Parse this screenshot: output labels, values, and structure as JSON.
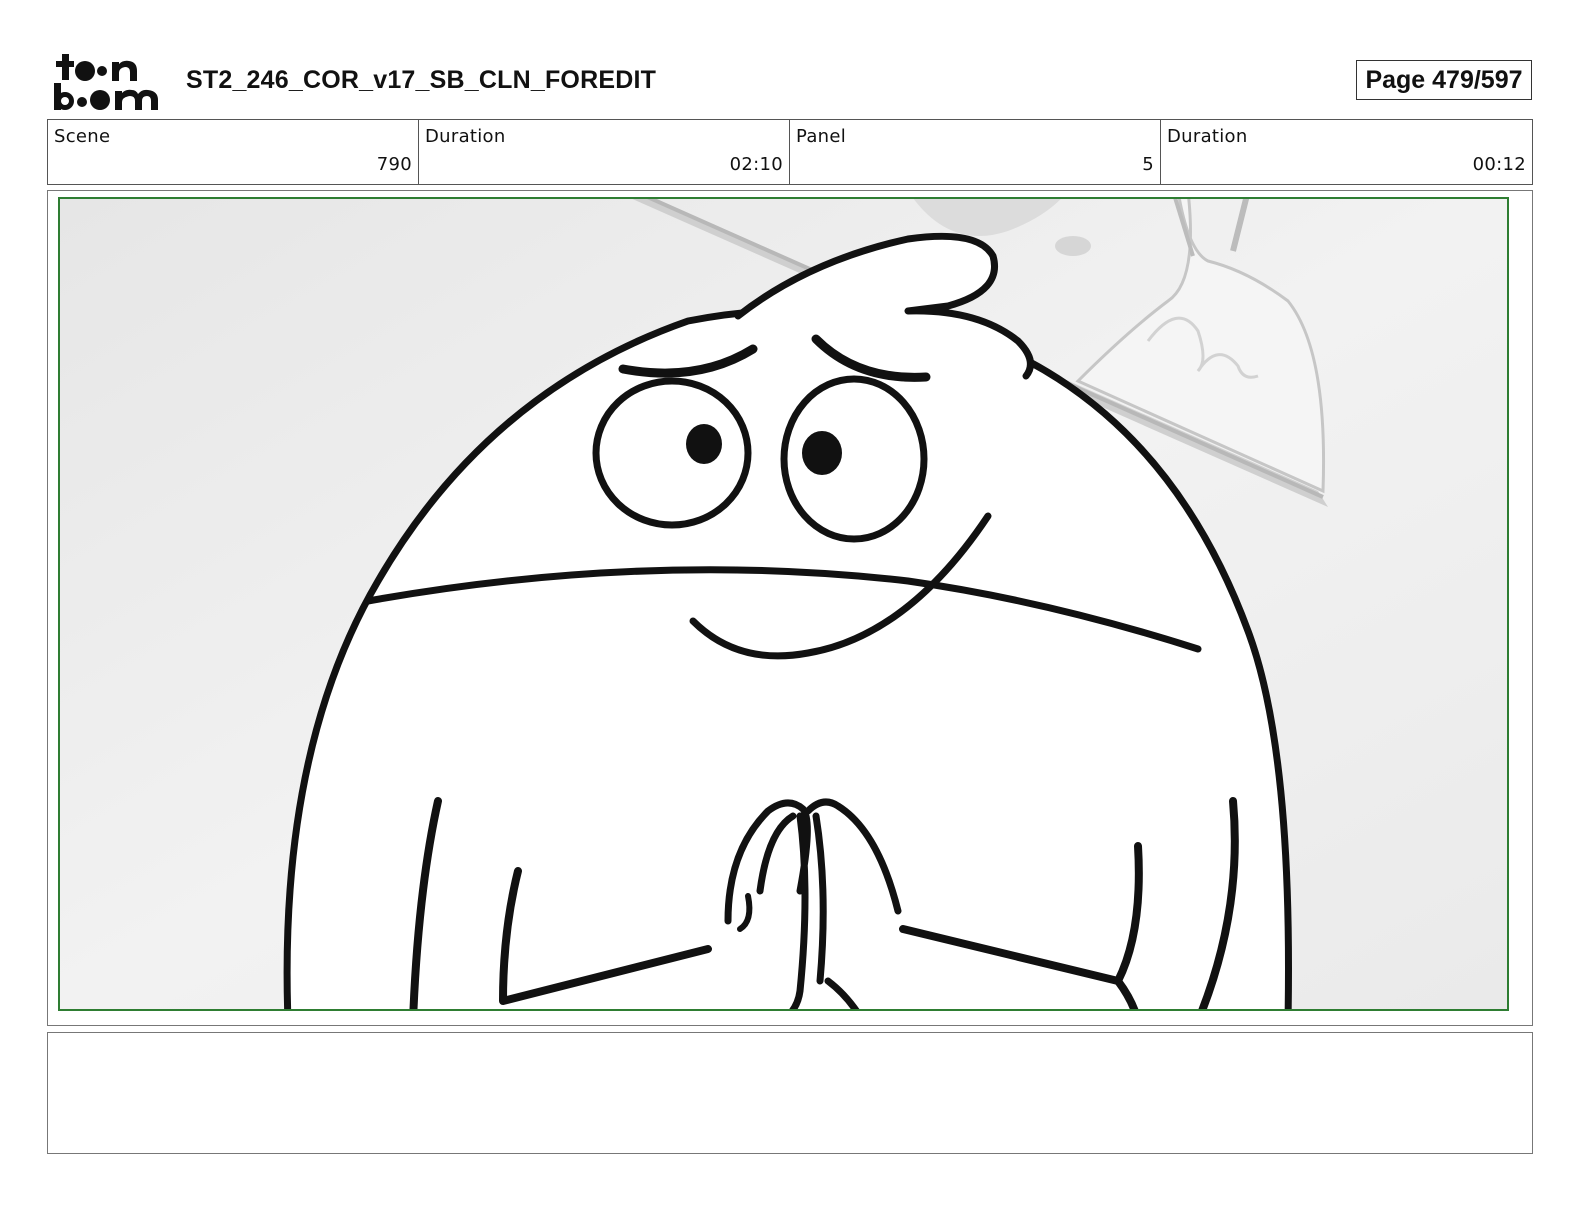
{
  "header": {
    "title": "ST2_246_COR_v17_SB_CLN_FOREDIT",
    "page": "Page 479/597",
    "logo_text": "toon boom"
  },
  "info": [
    {
      "label": "Scene",
      "value": "790"
    },
    {
      "label": "Duration",
      "value": "02:10"
    },
    {
      "label": "Panel",
      "value": "5"
    },
    {
      "label": "Duration",
      "value": "00:12"
    }
  ],
  "panel": {
    "frame_color": "#2e7d32",
    "description": ""
  },
  "notes": {
    "text": ""
  }
}
